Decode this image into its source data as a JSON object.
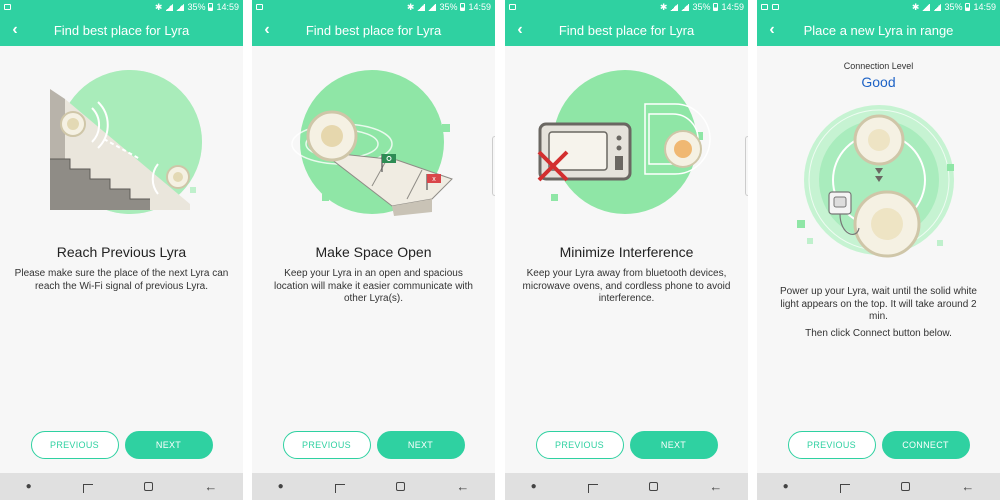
{
  "status": {
    "battery": "35%",
    "time": "14:59"
  },
  "screens": [
    {
      "title": "Find best place for Lyra",
      "heading": "Reach Previous Lyra",
      "description": "Please make sure the place of the next Lyra can reach the Wi-Fi signal of previous Lyra.",
      "prev_label": "PREVIOUS",
      "next_label": "NEXT"
    },
    {
      "title": "Find best place for Lyra",
      "heading": "Make Space Open",
      "description": "Keep your Lyra in an open and spacious location will make it easier communicate with other Lyra(s).",
      "prev_label": "PREVIOUS",
      "next_label": "NEXT"
    },
    {
      "title": "Find best place for Lyra",
      "heading": "Minimize Interference",
      "description": "Keep your Lyra away from bluetooth devices, microwave ovens, and cordless phone to avoid interference.",
      "prev_label": "PREVIOUS",
      "next_label": "NEXT"
    },
    {
      "title": "Place a new Lyra in range",
      "connection_label": "Connection Level",
      "connection_value": "Good",
      "description": "Power up your Lyra, wait until the solid white light appears on the top. It will take around 2 min.",
      "description2": "Then click Connect button below.",
      "prev_label": "PREVIOUS",
      "next_label": "CONNECT"
    }
  ],
  "colors": {
    "accent": "#2fd1a1",
    "good": "#1e63c6",
    "illustration": "#7fe0a0"
  }
}
